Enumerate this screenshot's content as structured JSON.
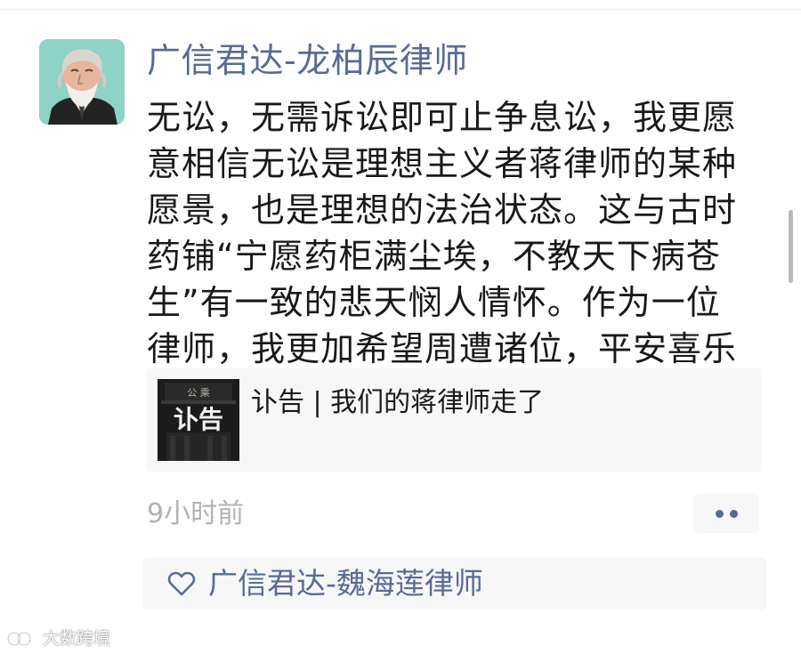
{
  "post": {
    "author": "广信君达-龙柏辰律师",
    "text_lines": [
      "无讼，无需诉讼即可止争息讼，我更愿",
      "意相信无讼是理想主义者蒋律师的某种",
      "愿景，也是理想的法治状态。这与古时",
      "药铺“宁愿药柜满尘埃，不教天下病苍",
      "生”有一致的悲天悯人情怀。作为一位",
      "律师，我更加希望周遭诸位，平安喜乐"
    ],
    "link_card": {
      "title": "讣告 | 我们的蒋律师走了",
      "thumb_text": "讣告",
      "thumb_sign": "公 乘"
    },
    "timestamp": "9小时前",
    "likes": {
      "names": "广信君达-魏海莲律师"
    }
  },
  "watermark": {
    "text": "大数跨境"
  },
  "colors": {
    "link_blue": "#576b95",
    "text": "#191919",
    "muted": "#b2b2b2",
    "card_bg": "#f7f7f7"
  },
  "icons": {
    "avatar": "avatar-illustration",
    "more": "more-dots-icon",
    "like": "heart-icon"
  }
}
